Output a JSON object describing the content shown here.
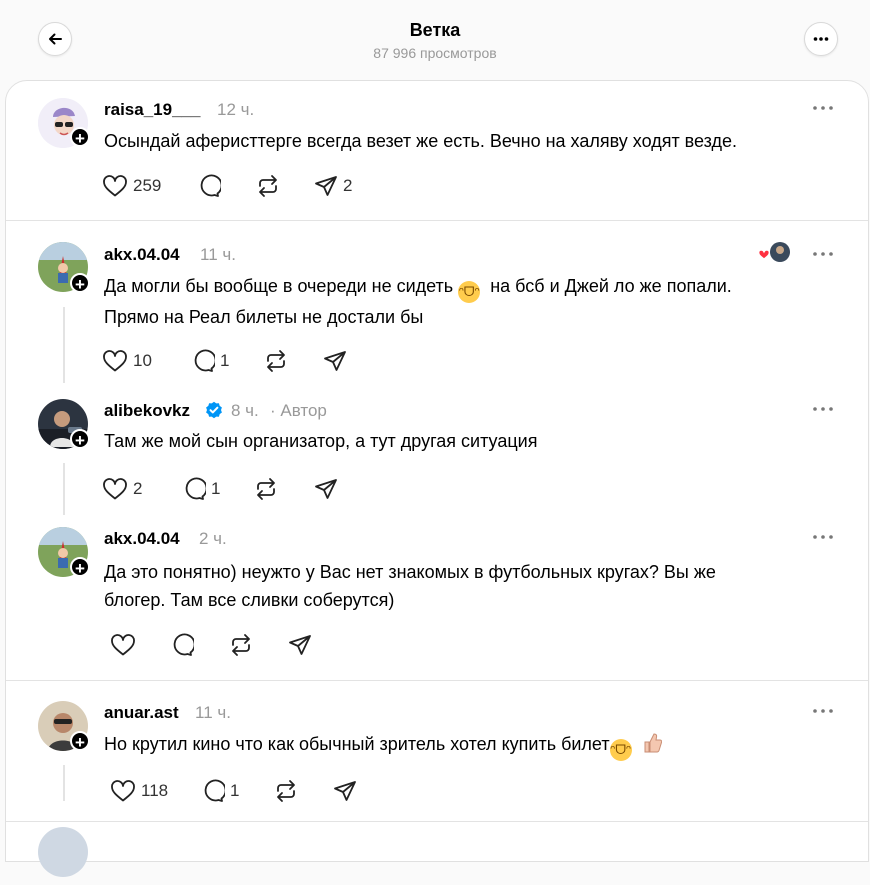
{
  "header": {
    "title": "Ветка",
    "views": "87 996 просмотров",
    "back_icon": "arrow-left-icon",
    "menu_icon": "more-horizontal-icon"
  },
  "posts": [
    {
      "username": "raisa_19___",
      "time": "12 ч.",
      "text_lines": [
        "Осындай аферисттерге всегда везет же есть. Вечно на халяву ходят везде."
      ],
      "likes": "259",
      "replies": "",
      "reposts": "",
      "shares": "2"
    },
    {
      "username": "akx.04.04",
      "time": "11 ч.",
      "text_lines": [
        "Да могли бы вообще в очереди не сидеть",
        "на бсб и Джей ло же попали.",
        "Прямо на Реал билеты не достали бы"
      ],
      "likes": "10",
      "replies": "1",
      "reposts": "",
      "shares": ""
    },
    {
      "username": "alibekovkz",
      "time": "8 ч.",
      "author_label": "· Автор",
      "verified": true,
      "text_lines": [
        "Там же мой сын организатор, а тут другая ситуация"
      ],
      "likes": "2",
      "replies": "1",
      "reposts": "",
      "shares": ""
    },
    {
      "username": "akx.04.04",
      "time": "2 ч.",
      "text_lines": [
        "Да это понятно) неужто у Вас нет знакомых в футбольных кругах? Вы же",
        "блогер. Там все сливки соберутся)"
      ],
      "likes": "",
      "replies": "",
      "reposts": "",
      "shares": ""
    },
    {
      "username": "anuar.ast",
      "time": "11 ч.",
      "text_lines": [
        "Но крутил кино что как обычный зритель хотел купить билет"
      ],
      "likes": "118",
      "replies": "1",
      "reposts": "",
      "shares": ""
    }
  ],
  "colors": {
    "verified": "#0095f6",
    "like_badge": "#ff3040",
    "muted": "#999999"
  }
}
